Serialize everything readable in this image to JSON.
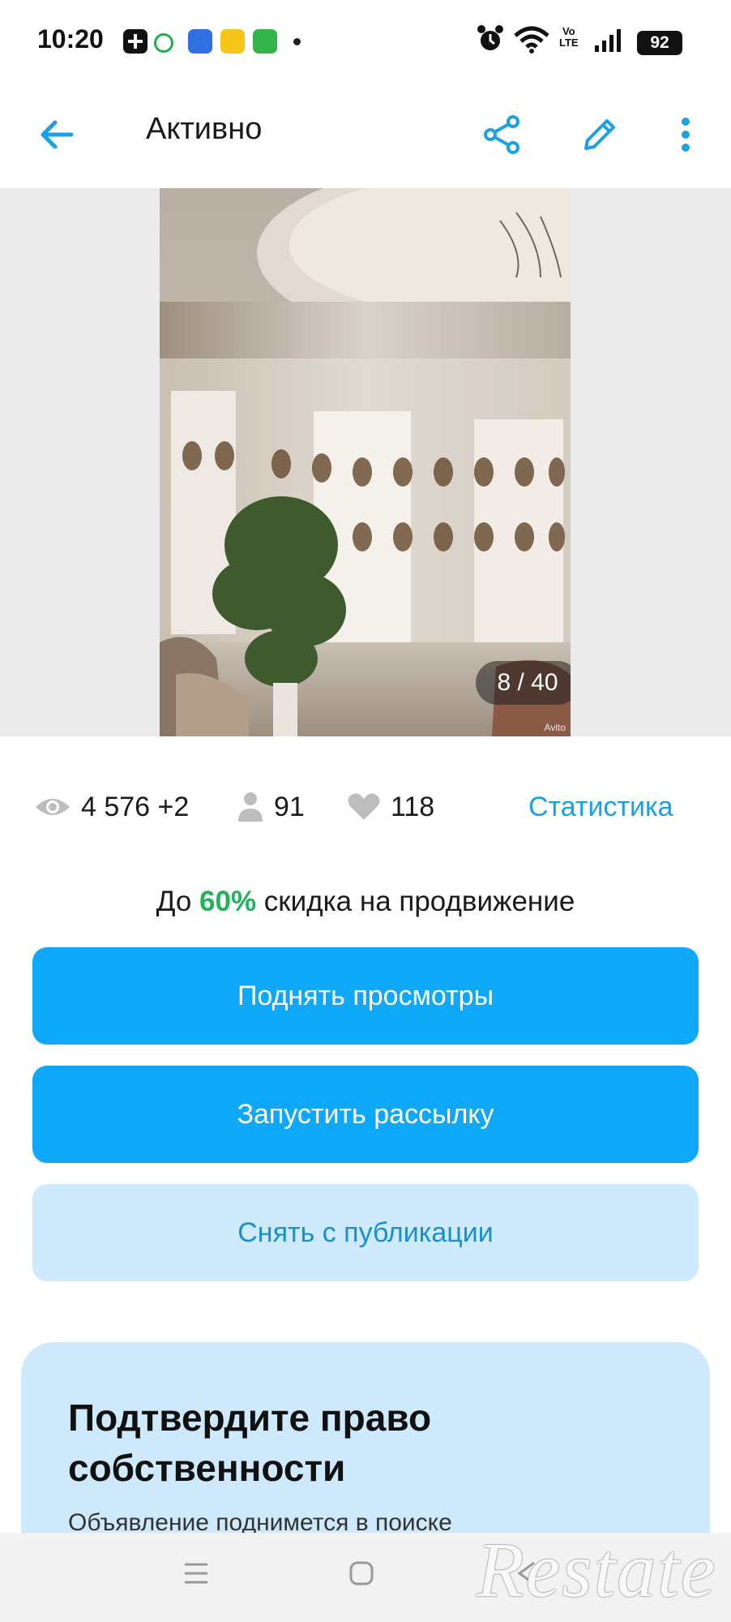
{
  "status_bar": {
    "time": "10:20",
    "volte_top": "Vo",
    "volte_bottom": "LTE",
    "battery": "92"
  },
  "app_bar": {
    "title": "Активно",
    "back_icon": "arrow-left-icon",
    "share_icon": "share-icon",
    "edit_icon": "pencil-icon",
    "menu_icon": "more-vertical-icon"
  },
  "gallery": {
    "counter": "8 / 40",
    "photo_watermark": "Avito"
  },
  "stats": {
    "views": "4 576 +2",
    "contacts": "91",
    "favorites": "118",
    "statistics_link": "Статистика"
  },
  "promo": {
    "prefix": "До ",
    "percent": "60%",
    "suffix": " скидка на продвижение"
  },
  "buttons": {
    "raise_views": "Поднять просмотры",
    "start_mailing": "Запустить рассылку",
    "unpublish": "Снять с публикации"
  },
  "ownership_card": {
    "title": "Подтвердите право собственности",
    "text": "Объявление поднимется в поиске"
  },
  "overlay_watermark": "Restate",
  "colors": {
    "accent": "#0fa7f8",
    "link": "#1aa0e6",
    "discount": "#1fb35a",
    "secondary_bg": "#cfeafc",
    "card_bg": "#cde9fb"
  }
}
